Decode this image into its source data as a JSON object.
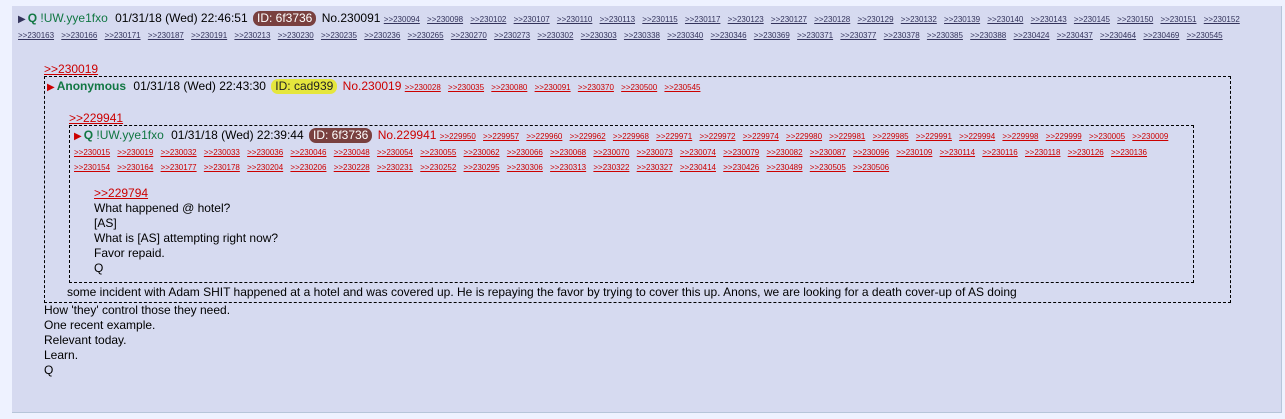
{
  "top": {
    "name": "Q",
    "trip": "!UW.yye1fxo",
    "date": "01/31/18 (Wed) 22:46:51",
    "id": "ID: 6f3736",
    "no": "No.230091",
    "refs": [
      ">>230094",
      ">>230098",
      ">>230102",
      ">>230107",
      ">>230110",
      ">>230113",
      ">>230115",
      ">>230117",
      ">>230123",
      ">>230127",
      ">>230128",
      ">>230129",
      ">>230132",
      ">>230139",
      ">>230140",
      ">>230143",
      ">>230145",
      ">>230150",
      ">>230151",
      ">>230152",
      ">>230163",
      ">>230166",
      ">>230171",
      ">>230187",
      ">>230191",
      ">>230213",
      ">>230230",
      ">>230235",
      ">>230236",
      ">>230265",
      ">>230270",
      ">>230273",
      ">>230302",
      ">>230303",
      ">>230338",
      ">>230340",
      ">>230346",
      ">>230369",
      ">>230371",
      ">>230377",
      ">>230378",
      ">>230385",
      ">>230388",
      ">>230424",
      ">>230437",
      ">>230464",
      ">>230469",
      ">>230545"
    ],
    "body": [
      "How 'they' control those they need.",
      "One recent example.",
      "Relevant today.",
      "Learn.",
      "Q"
    ]
  },
  "quote1": {
    "ref": ">>230019",
    "name": "Anonymous",
    "date": "01/31/18 (Wed) 22:43:30",
    "id": "ID: cad939",
    "no": "No.230019",
    "refs": [
      ">>230028",
      ">>230035",
      ">>230080",
      ">>230091",
      ">>230370",
      ">>230500",
      ">>230545"
    ],
    "body": "some incident with Adam SHIT happened at a hotel and was covered up. He is repaying the favor by trying to cover this up. Anons, we are looking for a death cover-up of AS doing"
  },
  "quote2": {
    "ref": ">>229941",
    "name": "Q",
    "trip": "!UW.yye1fxo",
    "date": "01/31/18 (Wed) 22:39:44",
    "id": "ID: 6f3736",
    "no": "No.229941",
    "refs": [
      ">>229950",
      ">>229957",
      ">>229960",
      ">>229962",
      ">>229968",
      ">>229971",
      ">>229972",
      ">>229974",
      ">>229980",
      ">>229981",
      ">>229985",
      ">>229991",
      ">>229994",
      ">>229998",
      ">>229999",
      ">>230005",
      ">>230009",
      ">>230015",
      ">>230019",
      ">>230032",
      ">>230033",
      ">>230036",
      ">>230046",
      ">>230048",
      ">>230054",
      ">>230055",
      ">>230062",
      ">>230066",
      ">>230068",
      ">>230070",
      ">>230073",
      ">>230074",
      ">>230079",
      ">>230082",
      ">>230087",
      ">>230096",
      ">>230109",
      ">>230114",
      ">>230116",
      ">>230118",
      ">>230126",
      ">>230136",
      ">>230154",
      ">>230164",
      ">>230177",
      ">>230178",
      ">>230204",
      ">>230206",
      ">>230228",
      ">>230231",
      ">>230252",
      ">>230295",
      ">>230306",
      ">>230313",
      ">>230322",
      ">>230327",
      ">>230414",
      ">>230426",
      ">>230489",
      ">>230505",
      ">>230506"
    ],
    "quote_ref": ">>229794",
    "body": [
      "What happened @ hotel?",
      "[AS]",
      "What is [AS] attempting right now?",
      "Favor repaid.",
      "Q"
    ]
  },
  "colors": {
    "background": "#eef2ff",
    "post": "#d6daf0",
    "name": "#117743",
    "link": "#c00000",
    "id_q": "#79403f",
    "id_anon": "#e5e63d"
  }
}
